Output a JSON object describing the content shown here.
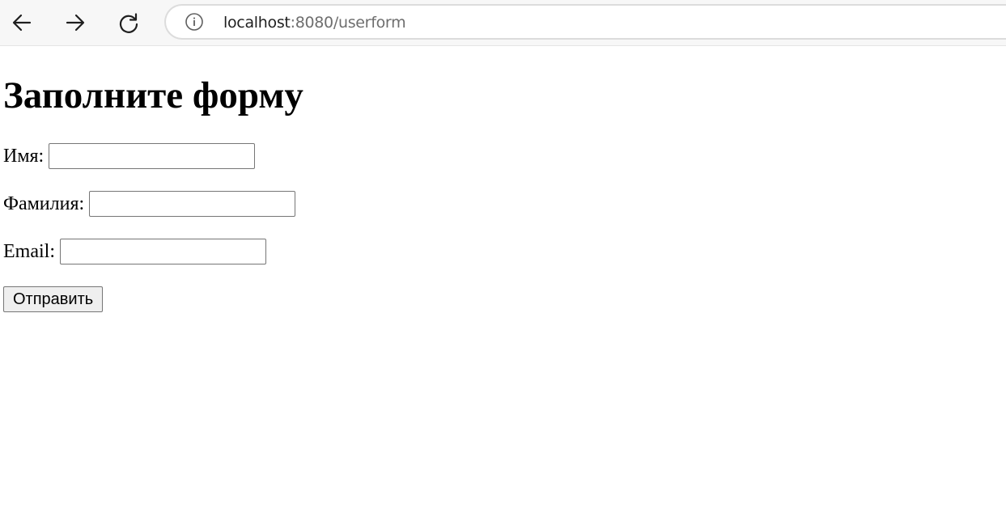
{
  "browser": {
    "url_host": "localhost",
    "url_path": ":8080/userform",
    "icons": {
      "back": "arrow-left-icon",
      "forward": "arrow-right-icon",
      "reload": "reload-icon",
      "info": "info-icon"
    }
  },
  "form": {
    "title": "Заполните форму",
    "fields": [
      {
        "label": "Имя:",
        "value": ""
      },
      {
        "label": "Фамилия:",
        "value": ""
      },
      {
        "label": "Email:",
        "value": ""
      }
    ],
    "submit_label": "Отправить"
  }
}
